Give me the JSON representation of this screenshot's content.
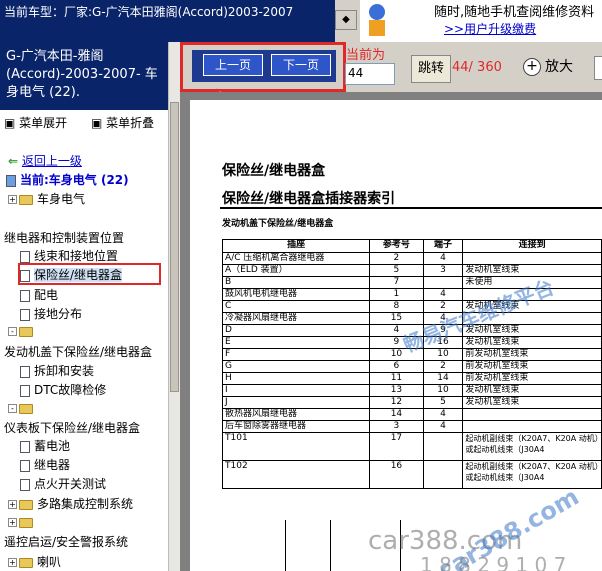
{
  "topbar": {
    "text": "当前车型：厂家:G-广汽本田雅阁(Accord)2003-2007"
  },
  "ad": {
    "line1": "随时,随地手机查阅维修资料",
    "line2": ">>用户升级缴费"
  },
  "left": {
    "current_title": "G-广汽本田-雅阁(Accord)-2003-2007- 车身电气 (22).",
    "expand_label": "菜单展开",
    "collapse_label": "菜单折叠",
    "back_label": "返回上一级",
    "current_label": "当前:车身电气 (22)",
    "tree": [
      {
        "label": "车身电气",
        "kind": "folder",
        "expand": "+"
      },
      {
        "label": "继电器和控制装置位置",
        "kind": "text"
      },
      {
        "label": "线束和接地位置",
        "kind": "doc"
      },
      {
        "label": "保险丝/继电器盒",
        "kind": "doc",
        "selected": true
      },
      {
        "label": "配电",
        "kind": "doc"
      },
      {
        "label": "接地分布",
        "kind": "doc"
      },
      {
        "label": "",
        "kind": "folder",
        "expand": "-"
      },
      {
        "label": "发动机盖下保险丝/继电器盒",
        "kind": "text"
      },
      {
        "label": "拆卸和安装",
        "kind": "doc"
      },
      {
        "label": "DTC故障检修",
        "kind": "doc"
      },
      {
        "label": "",
        "kind": "folder",
        "expand": "-"
      },
      {
        "label": "仪表板下保险丝/继电器盒",
        "kind": "text"
      },
      {
        "label": "蓄电池",
        "kind": "doc"
      },
      {
        "label": "继电器",
        "kind": "doc"
      },
      {
        "label": "点火开关测试",
        "kind": "doc"
      },
      {
        "label": "多路集成控制系统",
        "kind": "folder",
        "expand": "+"
      },
      {
        "label": "",
        "kind": "folder",
        "expand": "+"
      },
      {
        "label": "遥控启运/安全警报系统",
        "kind": "text"
      },
      {
        "label": "喇叭",
        "kind": "folder",
        "expand": "+"
      }
    ]
  },
  "toolbar": {
    "prev_label": "上一页",
    "next_label": "下一页",
    "page_label": "当前为",
    "page_value": "44",
    "goto_label": "跳转",
    "page_total": "44/ 360",
    "zoom_label": "放大"
  },
  "doc": {
    "heading1": "保险丝/继电器盒",
    "heading2": "保险丝/继电器盒插接器索引",
    "subheading": "发动机盖下保险丝/继电器盒",
    "columns": [
      "插座",
      "参考号",
      "端子",
      "连接到"
    ],
    "rows": [
      [
        "A/C 压缩机离合器继电器",
        "2",
        "4",
        ""
      ],
      [
        "A（ELD 装置）",
        "5",
        "3",
        "发动机室线束"
      ],
      [
        "B",
        "7",
        "",
        "未使用"
      ],
      [
        "鼓风机电机继电器",
        "1",
        "4",
        ""
      ],
      [
        "C",
        "8",
        "2",
        "发动机室线束"
      ],
      [
        "冷凝器风扇继电器",
        "15",
        "4",
        ""
      ],
      [
        "D",
        "4",
        "9",
        "发动机室线束"
      ],
      [
        "E",
        "9",
        "16",
        "发动机室线束"
      ],
      [
        "F",
        "10",
        "10",
        "前发动机室线束"
      ],
      [
        "G",
        "6",
        "2",
        "前发动机室线束"
      ],
      [
        "H",
        "11",
        "14",
        "前发动机室线束"
      ],
      [
        "I",
        "13",
        "10",
        "发动机室线束"
      ],
      [
        "J",
        "12",
        "5",
        "发动机室线束"
      ],
      [
        "散热器风扇继电器",
        "14",
        "4",
        ""
      ],
      [
        "后车窗除雾器继电器",
        "3",
        "4",
        ""
      ]
    ],
    "rows_tall": [
      [
        "T101",
        "17",
        "",
        "起动机副线束（K20A7、K20A 动机）或起动机线束（J30A4"
      ],
      [
        "T102",
        "16",
        "",
        "起动机副线束（K20A7、K20A 动机）或起动机线束（J30A4"
      ]
    ]
  },
  "watermarks": {
    "w1": "畅易汽车维修平台",
    "w2": "car388.com",
    "w3": "car388.com",
    "w4": "1 8 8 2 9 1 0 7"
  },
  "colors": {
    "nav_blue": "#0a246a",
    "highlight_red": "#e02828",
    "link_blue": "#0000cc"
  }
}
